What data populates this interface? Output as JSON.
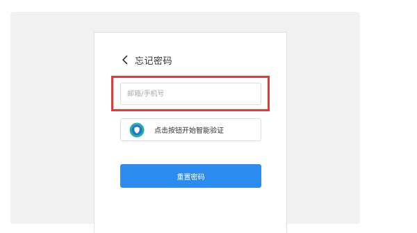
{
  "header": {
    "title": "忘记密码",
    "back_icon": "chevron-left-icon"
  },
  "form": {
    "account_placeholder": "邮箱/手机号",
    "account_value": "",
    "captcha_label": "点击按钮开始智能验证",
    "captcha_icon": "shield-check-icon",
    "submit_label": "重置密码"
  },
  "colors": {
    "accent": "#2d8cf0",
    "highlight": "#e53935",
    "shield_outer": "#1bb99a"
  }
}
